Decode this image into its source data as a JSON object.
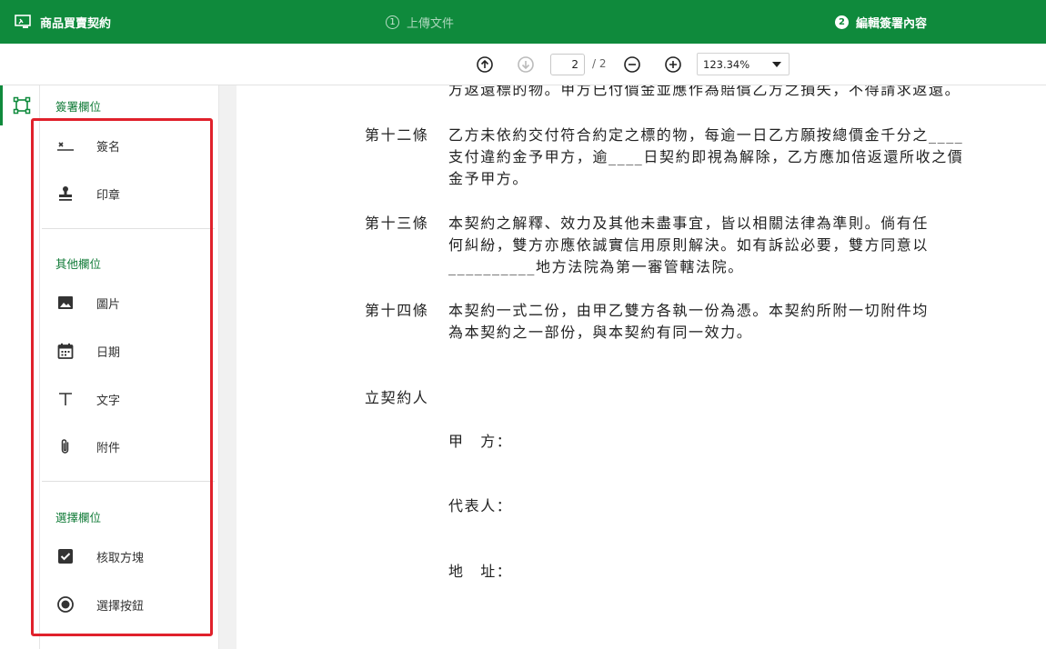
{
  "header": {
    "doc_title": "商品買賣契約",
    "steps": [
      {
        "num": "1",
        "label": "上傳文件"
      },
      {
        "num": "2",
        "label": "編輯簽署內容"
      }
    ]
  },
  "toolbar": {
    "page_current": "2",
    "page_total": "/ 2",
    "zoom": "123.34%"
  },
  "panel": {
    "sections": [
      {
        "title": "簽署欄位",
        "items": [
          "簽名",
          "印章"
        ]
      },
      {
        "title": "其他欄位",
        "items": [
          "圖片",
          "日期",
          "文字",
          "附件"
        ]
      },
      {
        "title": "選擇欄位",
        "items": [
          "核取方塊",
          "選擇按鈕"
        ]
      }
    ]
  },
  "document": {
    "top_cut_line": "方返還標的物。甲方已付價金並應作為賠償乙方之損失，不得請求返還。",
    "articles": [
      {
        "label": "第十二條",
        "lines": [
          "乙方未依約交付符合約定之標的物，每逾一日乙方願按總價金千分之____",
          "支付違約金予甲方，逾____日契約即視為解除，乙方應加倍返還所收之價",
          "金予甲方。"
        ]
      },
      {
        "label": "第十三條",
        "lines": [
          "本契約之解釋、效力及其他未盡事宜，皆以相關法律為準則。倘有任",
          "何糾紛，雙方亦應依誠實信用原則解決。如有訴訟必要，雙方同意以",
          "__________地方法院為第一審管轄法院。"
        ]
      },
      {
        "label": "第十四條",
        "lines": [
          "本契約一式二份，由甲乙雙方各執一份為憑。本契約所附一切附件均",
          "為本契約之一部份，與本契約有同一效力。"
        ]
      }
    ],
    "signatory_label": "立契約人",
    "fields": [
      "甲　方：",
      "代表人：",
      "地　址："
    ]
  },
  "colors": {
    "brand": "#0f8a3c",
    "highlight": "#e0212b"
  },
  "icons": [
    "document-sign-icon",
    "arrow-up-circle-icon",
    "arrow-down-circle-icon",
    "zoom-out-icon",
    "zoom-in-icon",
    "field-tool-icon",
    "signature-icon",
    "stamp-icon",
    "image-icon",
    "calendar-icon",
    "text-icon",
    "paperclip-icon",
    "checkbox-icon",
    "radio-icon"
  ]
}
